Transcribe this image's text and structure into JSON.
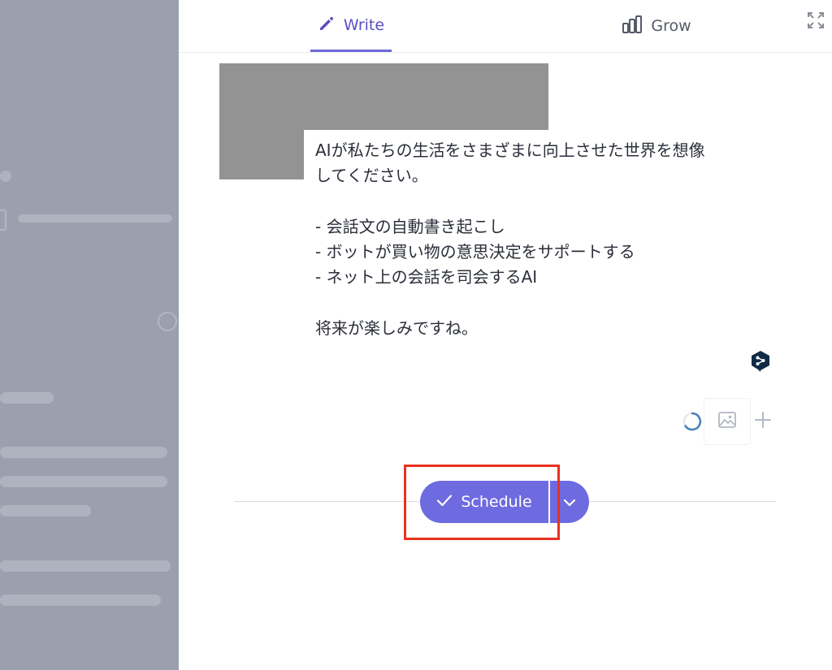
{
  "tabs": {
    "write_label": "Write",
    "grow_label": "Grow"
  },
  "post": {
    "lines": [
      "AIが私たちの生活をさまざまに向上させた世界を想像",
      "してください。",
      "",
      "- 会話文の自動書き起こし",
      "- ボットが買い物の意思決定をサポートする",
      "- ネット上の会話を司会するAI",
      "",
      "将来が楽しみですね。"
    ]
  },
  "footer": {
    "schedule_label": "Schedule"
  },
  "icons": {
    "write": "pencil-icon",
    "grow": "bar-chart-icon",
    "expand": "expand-icon",
    "translate": "deepl-icon",
    "loading": "loading-spinner-icon",
    "image": "image-icon",
    "add": "plus-icon",
    "check": "check-icon",
    "dropdown": "chevron-down-icon"
  },
  "colors": {
    "accent": "#6e6ae0",
    "active_tab_text": "#5a4fc6",
    "highlight": "#e8321f",
    "backdrop": "#9aa0ad"
  }
}
